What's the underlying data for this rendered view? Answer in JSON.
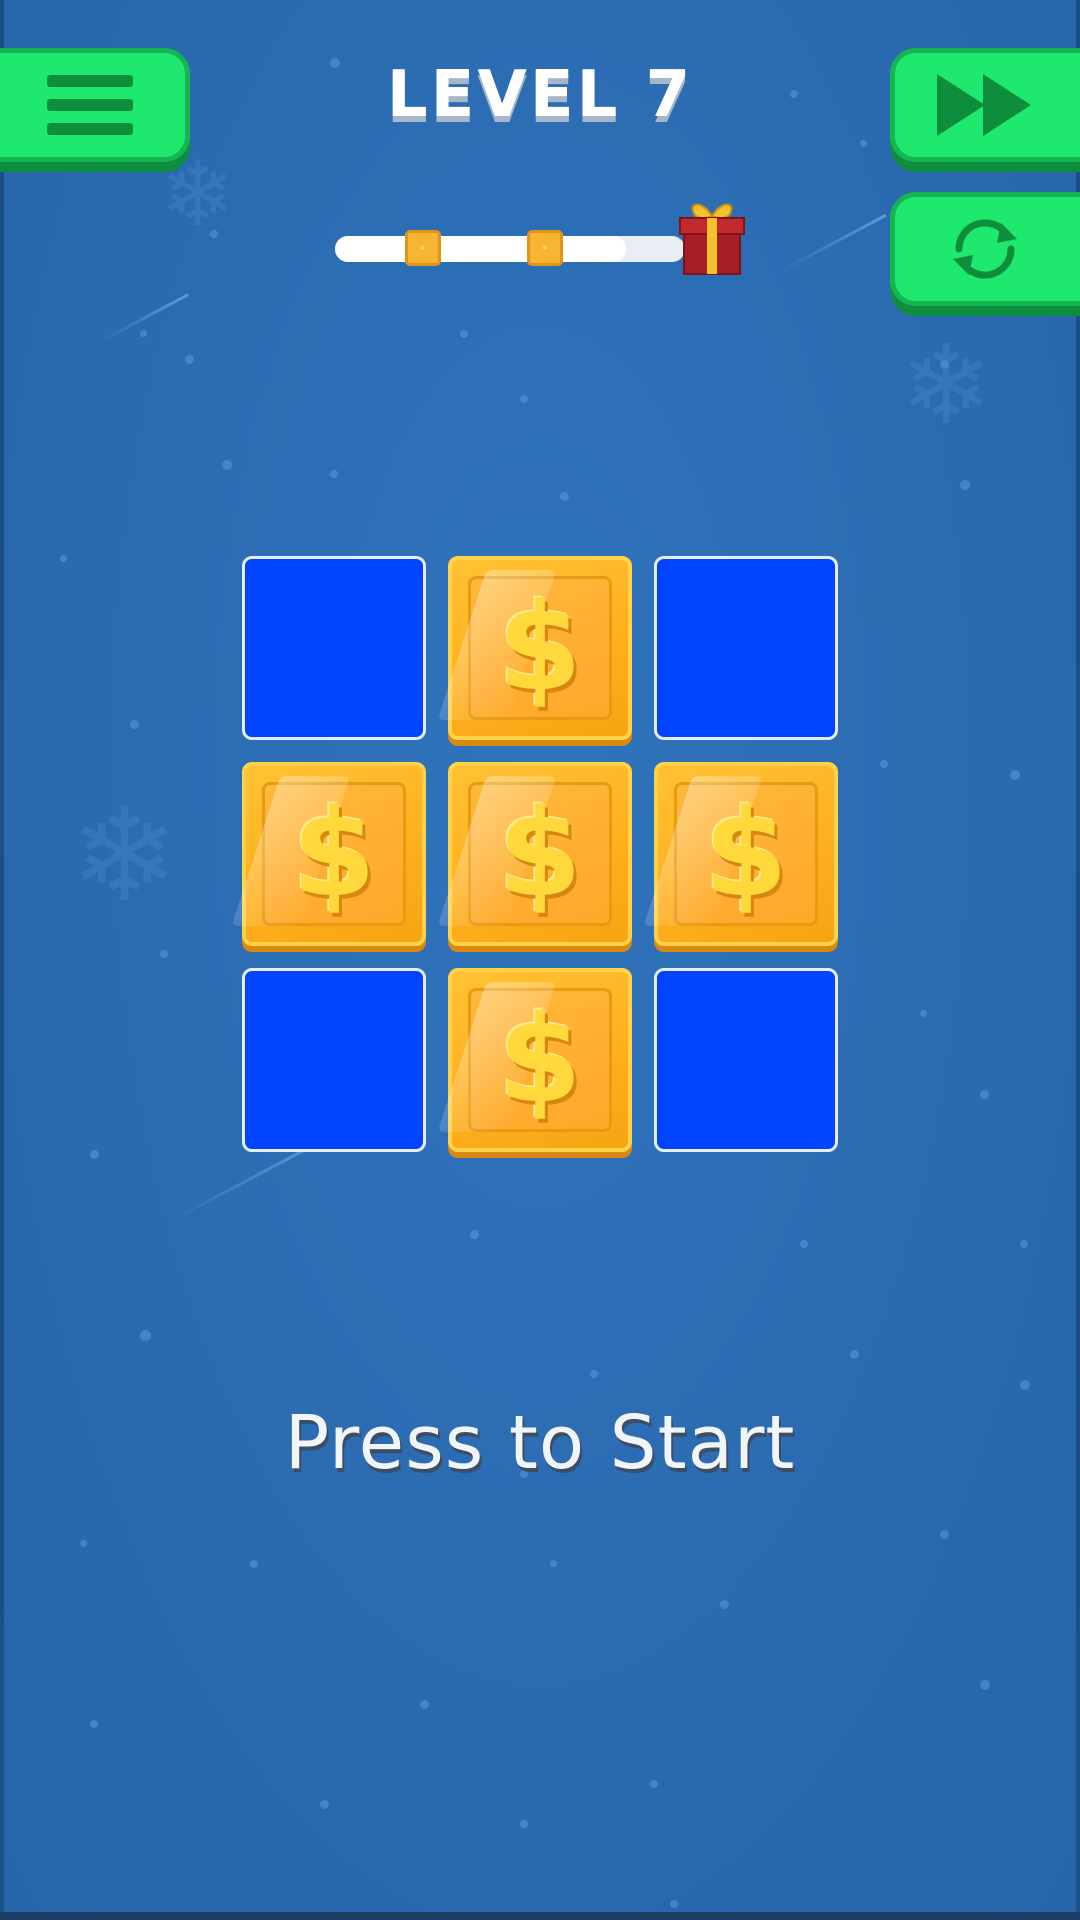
{
  "header": {
    "level_title": "LEVEL 7"
  },
  "buttons": {
    "menu_icon": "hamburger-menu-icon",
    "skip_icon": "fast-forward-icon",
    "restart_icon": "refresh-icon"
  },
  "progress": {
    "fill_fraction": 0.83,
    "star_markers": [
      {
        "fraction": 0.25
      },
      {
        "fraction": 0.6
      }
    ],
    "reward_icon": "gift-icon"
  },
  "board": {
    "rows": 3,
    "cols": 3,
    "tiles": [
      [
        "blue",
        "coin",
        "blue"
      ],
      [
        "coin",
        "coin",
        "coin"
      ],
      [
        "blue",
        "coin",
        "blue"
      ]
    ],
    "coin_symbol": "$"
  },
  "prompt": {
    "start_text": "Press to Start"
  },
  "colors": {
    "background": "#2b6db4",
    "button_green": "#1fe86e",
    "tile_blue": "#0044ff",
    "tile_gold": "#ffb01f"
  }
}
